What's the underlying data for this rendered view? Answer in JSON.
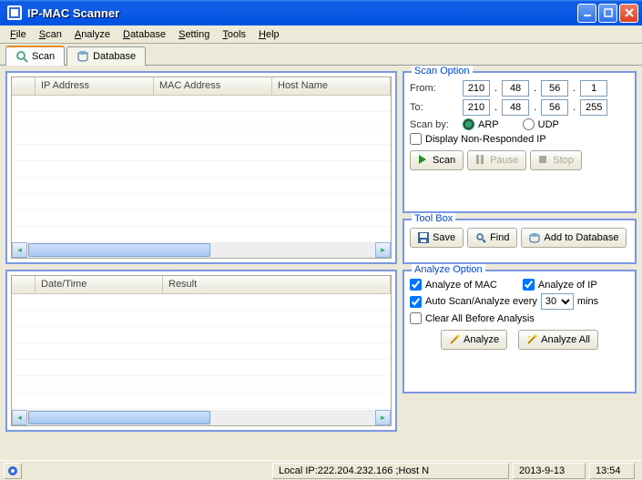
{
  "window": {
    "title": "IP-MAC Scanner"
  },
  "menu": {
    "file": "File",
    "scan": "Scan",
    "analyze": "Analyze",
    "database": "Database",
    "setting": "Setting",
    "tools": "Tools",
    "help": "Help"
  },
  "tabs": {
    "scan": "Scan",
    "database": "Database"
  },
  "grid1": {
    "col_blank": "",
    "col_ip": "IP Address",
    "col_mac": "MAC Address",
    "col_host": "Host Name"
  },
  "grid2": {
    "col_blank": "",
    "col_time": "Date/Time",
    "col_result": "Result"
  },
  "scanopt": {
    "legend": "Scan Option",
    "from": "From:",
    "to": "To:",
    "ip_from": [
      "210",
      "48",
      "56",
      "1"
    ],
    "ip_to": [
      "210",
      "48",
      "56",
      "255"
    ],
    "scanby": "Scan by:",
    "arp": "ARP",
    "udp": "UDP",
    "display": "Display Non-Responded IP",
    "scan_btn": "Scan",
    "pause_btn": "Pause",
    "stop_btn": "Stop"
  },
  "toolbox": {
    "legend": "Tool Box",
    "save": "Save",
    "find": "Find",
    "add": "Add to Database"
  },
  "analyze": {
    "legend": "Analyze Option",
    "mac": "Analyze of MAC",
    "ip": "Analyze of IP",
    "auto_pre": "Auto Scan/Analyze every",
    "auto_post": "mins",
    "interval": "30",
    "clear": "Clear All Before Analysis",
    "analyze_btn": "Analyze",
    "analyze_all_btn": "Analyze All"
  },
  "status": {
    "local": "Local IP:222.204.232.166 ;Host N",
    "date": "2013-9-13",
    "time": "13:54"
  }
}
